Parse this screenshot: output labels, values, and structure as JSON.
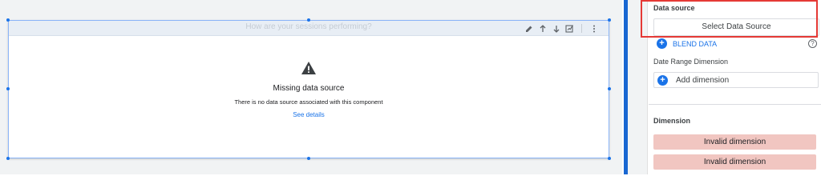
{
  "canvas": {
    "chart": {
      "title": "How are your sessions performing?",
      "actions": [
        {
          "name": "edit-icon",
          "glyph": "✎"
        },
        {
          "name": "arrow-up-icon",
          "glyph": "↑"
        },
        {
          "name": "arrow-down-icon",
          "glyph": "↓"
        },
        {
          "name": "explore-chart-icon",
          "glyph": "⧉"
        },
        {
          "name": "more-vert-icon",
          "glyph": "⋮"
        }
      ],
      "error": {
        "icon": "warning-icon",
        "title": "Missing data source",
        "message": "There is no data source associated with this component",
        "link": "See details"
      }
    }
  },
  "panel": {
    "data_source_label": "Data source",
    "select_data_source": "Select Data Source",
    "blend_data": "BLEND DATA",
    "help_glyph": "?",
    "date_range_dimension_label": "Date Range Dimension",
    "add_dimension": "Add dimension",
    "dimension_label": "Dimension",
    "invalid_dimensions": [
      "Invalid dimension",
      "Invalid dimension"
    ]
  },
  "colors": {
    "accent": "#1a73e8",
    "highlight": "#e53935",
    "invalid_chip": "#f1c6c1",
    "divider": "#1967d2"
  }
}
